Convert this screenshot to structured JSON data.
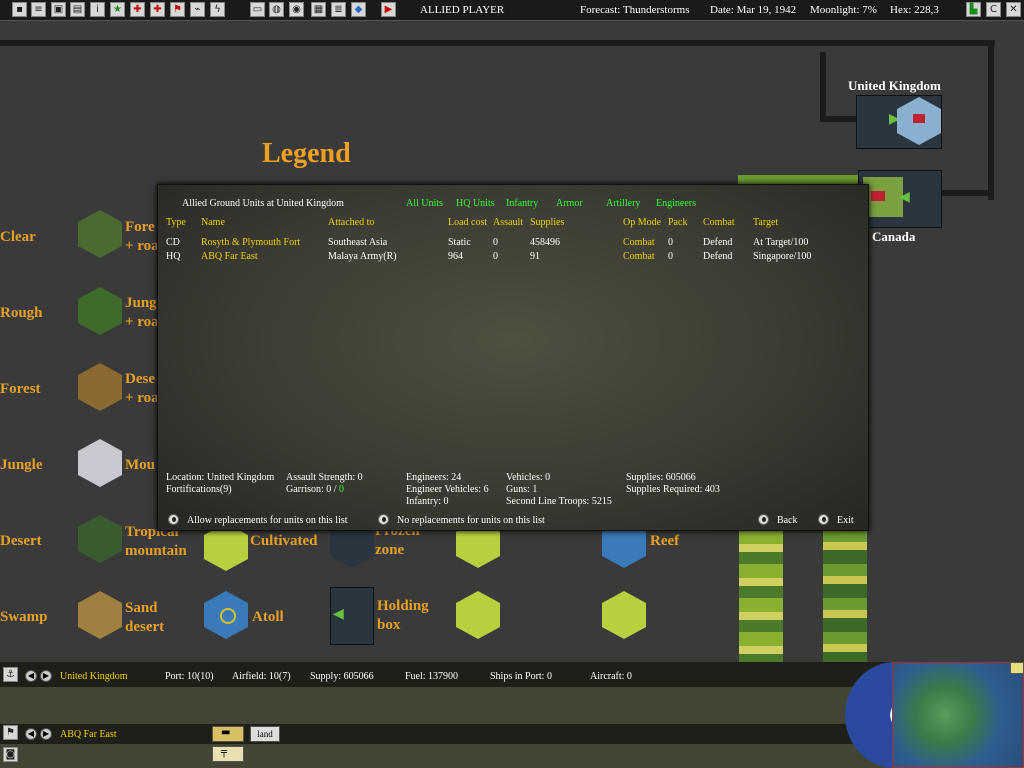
{
  "topbar": {
    "player": "ALLIED PLAYER",
    "forecast": "Forecast: Thunderstorms",
    "date": "Date: Mar 19, 1942",
    "moonlight": "Moonlight: 7%",
    "hex": "Hex: 228,3"
  },
  "map": {
    "legend_title": "Legend",
    "uk_label": "United Kingdom",
    "canada_label": "Canada",
    "terrain_left": [
      "Clear",
      "Rough",
      "Forest",
      "Jungle",
      "Desert",
      "Swamp"
    ],
    "col2": {
      "forest_road": [
        "Fore",
        "+ roa"
      ],
      "jungle_road": [
        "Jung",
        "+ roa"
      ],
      "desert_road": [
        "Dese",
        "+ roa"
      ],
      "mountain": "Mou",
      "tropical_mountain": [
        "Tropical",
        "mountain"
      ],
      "sand_desert": [
        "Sand",
        "desert"
      ]
    },
    "cultivated": "Cultivated",
    "atoll": "Atoll",
    "frozen_zone": [
      "Frozen",
      "zone"
    ],
    "holding_box": [
      "Holding",
      "box"
    ],
    "reef": "Reef"
  },
  "dialog": {
    "title": "Allied Ground Units at United Kingdom",
    "filters": [
      "All Units",
      "HQ Units",
      "Infantry",
      "Armor",
      "Artillery",
      "Engineers"
    ],
    "columns": [
      "Type",
      "Name",
      "Attached to",
      "Load cost",
      "Assault",
      "Supplies",
      "Op Mode",
      "Pack",
      "Combat",
      "Target"
    ],
    "rows": [
      {
        "type": "CD",
        "name": "Rosyth & Plymouth Fort",
        "attached": "Southeast Asia",
        "load": "Static",
        "assault": "0",
        "supplies": "458496",
        "opmode": "Combat",
        "pack": "0",
        "combat": "Defend",
        "target": "At Target/100"
      },
      {
        "type": "HQ",
        "name": "ABQ Far East",
        "attached": "Malaya Army(R)",
        "load": "964",
        "assault": "0",
        "supplies": "91",
        "opmode": "Combat",
        "pack": "0",
        "combat": "Defend",
        "target": "Singapore/100"
      }
    ],
    "summary": {
      "location": "Location: United Kingdom",
      "fortifications": "Fortifications(9)",
      "assault_strength": "Assault Strength: 0",
      "garrison": "Garrison: 0 /",
      "garrison_val": "0",
      "engineers": "Engineers: 24",
      "engineer_vehicles": "Engineer Vehicles: 6",
      "infantry": "Infantry: 0",
      "vehicles": "Vehicles: 0",
      "guns": "Guns: 1",
      "second_line": "Second Line Troops: 5215",
      "supplies": "Supplies: 605066",
      "supplies_required": "Supplies Required: 403"
    },
    "allow_replacements": "Allow replacements for units on this list",
    "no_replacements": "No replacements for units on this list",
    "back": "Back",
    "exit": "Exit"
  },
  "bottom": {
    "base_name": "United Kingdom",
    "port": "Port: 10(10)",
    "airfield": "Airfield: 10(7)",
    "supply": "Supply: 605066",
    "fuel": "Fuel: 137900",
    "ships": "Ships in Port: 0",
    "aircraft": "Aircraft: 0",
    "unit_name": "ABQ Far East",
    "land_btn": "land"
  }
}
